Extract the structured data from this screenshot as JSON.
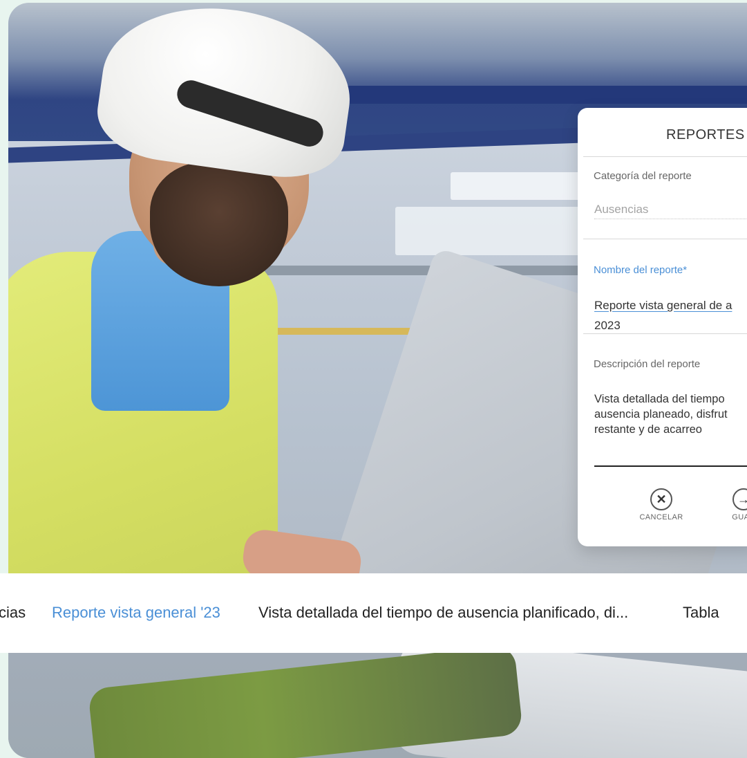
{
  "report_card": {
    "title": "REPORTES",
    "category": {
      "label": "Categoría del reporte",
      "value": "Ausencias"
    },
    "name": {
      "label": "Nombre del reporte*",
      "value_line1": "Reporte vista general de a",
      "value_line2": "2023"
    },
    "description": {
      "label": "Descripción del reporte",
      "line1": "Vista detallada del tiempo",
      "line2": "ausencia planeado, disfrut",
      "line3": "restante y de acarreo"
    },
    "actions": {
      "cancel_label": "CANCELAR",
      "save_label": "GUAR"
    }
  },
  "summary_strip": {
    "category": "cias",
    "report_name": "Reporte vista general '23",
    "description": "Vista detallada del tiempo de ausencia planificado, di...",
    "view_type": "Tabla"
  },
  "colors": {
    "accent": "#4a8fd6",
    "card_bg": "#ffffff",
    "text": "#333333"
  },
  "icons": {
    "cancel": "close-circle-icon",
    "save": "arrow-right-circle-icon"
  }
}
